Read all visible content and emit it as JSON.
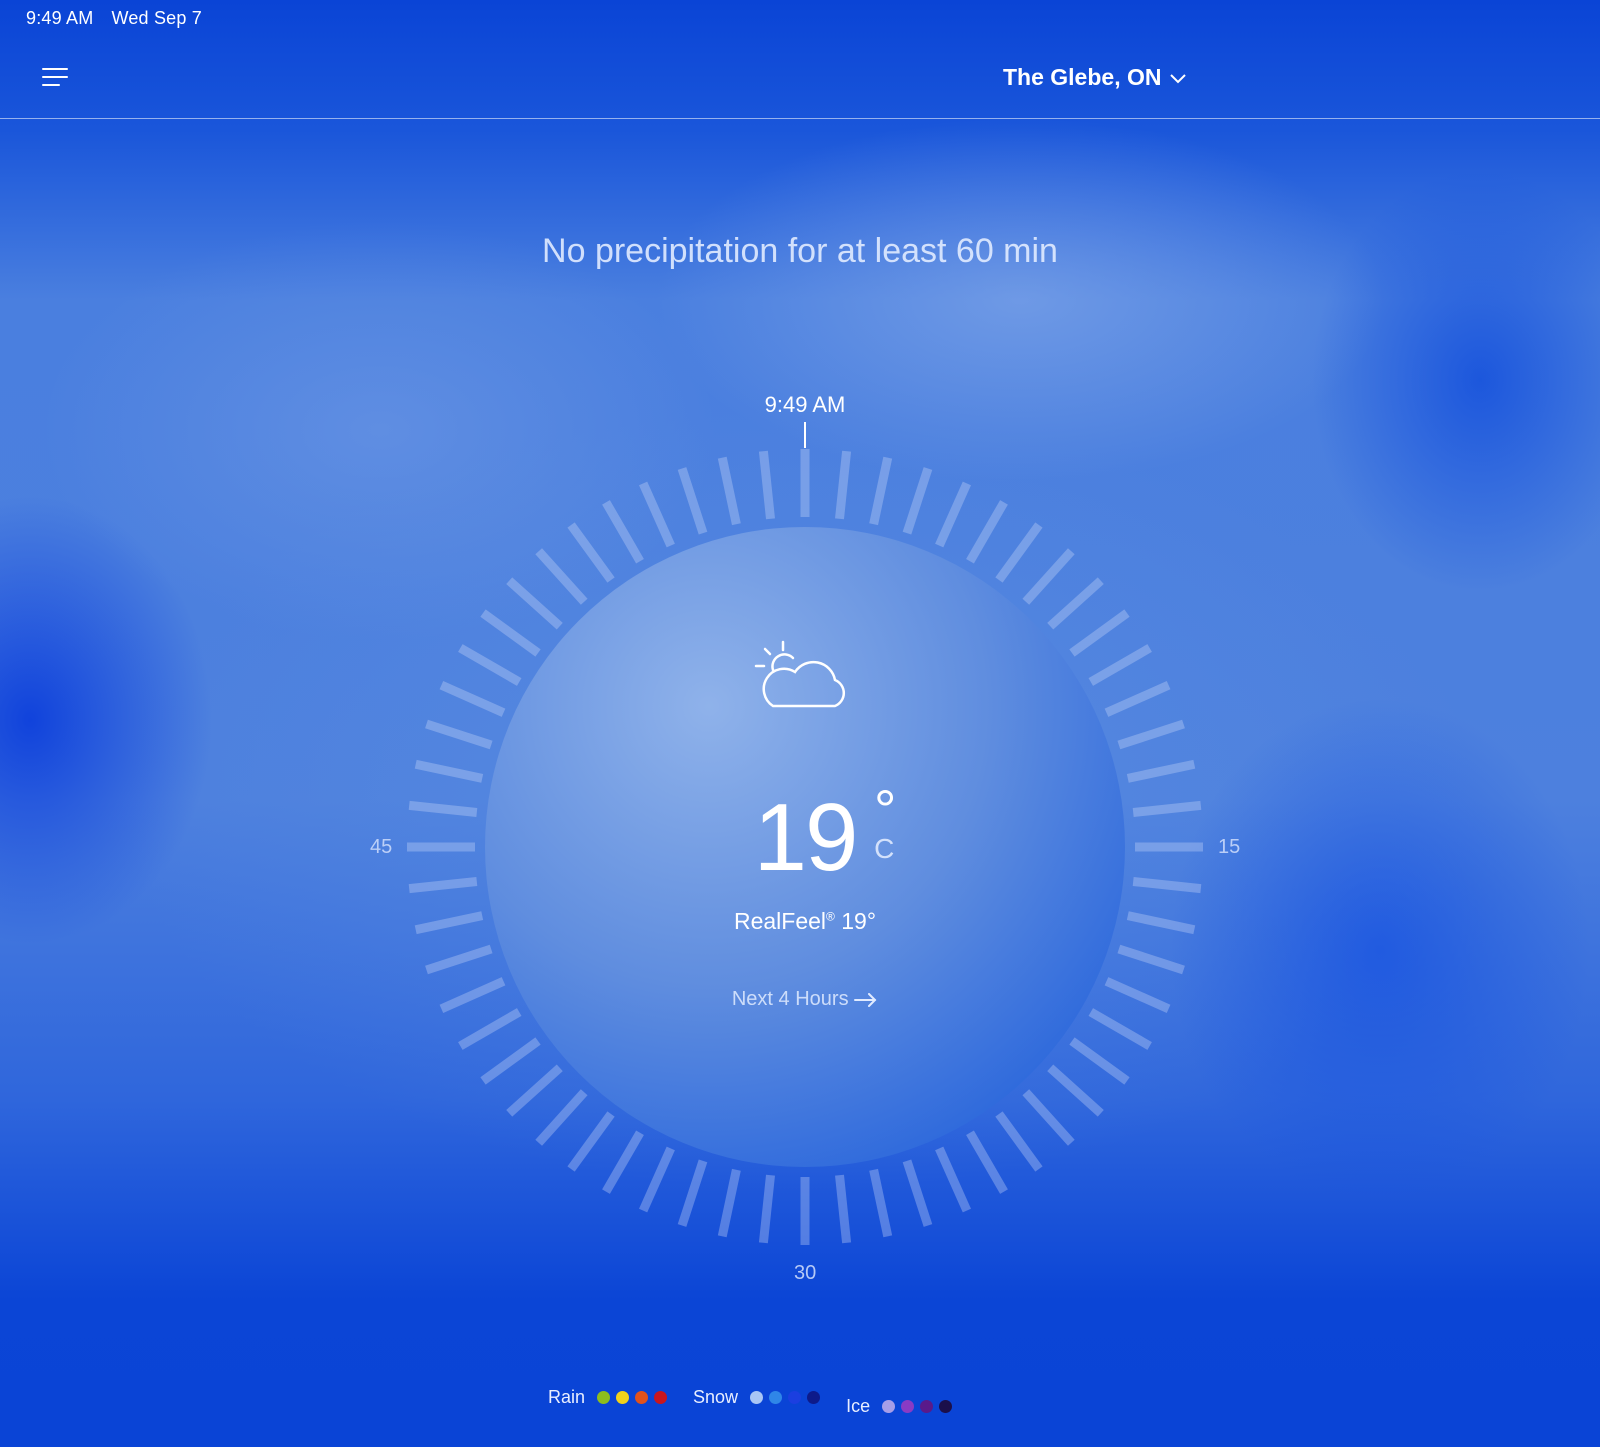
{
  "status_bar": {
    "time": "9:49 AM",
    "date": "Wed Sep 7"
  },
  "header": {
    "location": "The Glebe, ON",
    "menu_icon": "hamburger-menu-icon",
    "dropdown_icon": "chevron-down-icon"
  },
  "headline": "No precipitation for at least 60 min",
  "dial": {
    "current_time": "9:49 AM",
    "labels": {
      "right": "15",
      "bottom": "30",
      "left": "45"
    },
    "tick_count": 60
  },
  "current": {
    "condition_icon": "partly-sunny-cloud-icon",
    "temperature": "19",
    "degree_symbol": "°",
    "unit": "C",
    "realfeel_label": "RealFeel",
    "realfeel_mark": "®",
    "realfeel_value": "19°",
    "next_link": "Next 4 Hours",
    "next_icon": "arrow-right-icon"
  },
  "legend": [
    {
      "label": "Rain",
      "colors": [
        "#8dbd1d",
        "#f2d21a",
        "#e2521c",
        "#c8161e"
      ]
    },
    {
      "label": "Snow",
      "colors": [
        "#a9c6f5",
        "#2f86e8",
        "#1b3fe0",
        "#0d1a8a"
      ]
    },
    {
      "label": "Ice",
      "colors": [
        "#a79ee8",
        "#8a3bc4",
        "#5a1a8a",
        "#1b0f4a"
      ]
    }
  ]
}
